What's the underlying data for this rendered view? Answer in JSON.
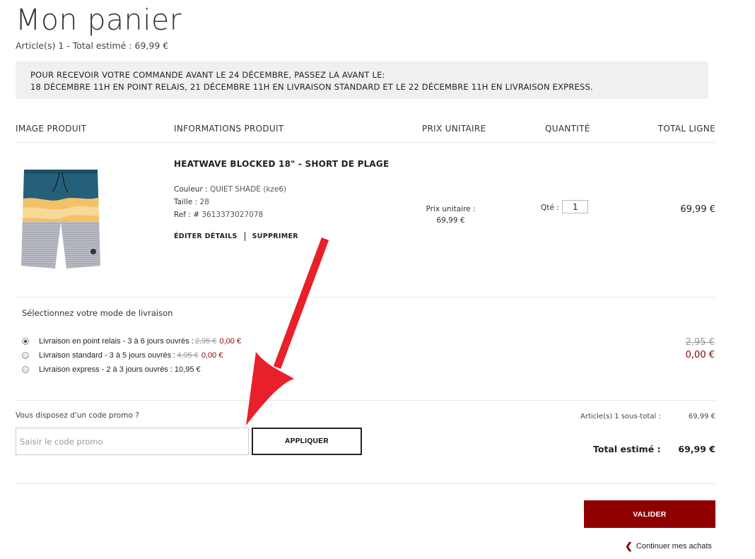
{
  "page": {
    "title": "Mon panier",
    "summary": "Article(s) 1 - Total estimé : 69,99 €"
  },
  "notice": {
    "line1": "POUR RECEVOIR VOTRE COMMANDE AVANT LE 24 DÉCEMBRE, PASSEZ LA AVANT LE:",
    "line2": "18 DÉCEMBRE 11H EN POINT RELAIS, 21 DÉCEMBRE 11H EN LIVRAISON STANDARD ET LE 22 DÉCEMBRE 11H EN LIVRAISON EXPRESS."
  },
  "table": {
    "headers": {
      "image": "IMAGE PRODUIT",
      "info": "INFORMATIONS PRODUIT",
      "unit_price": "PRIX UNITAIRE",
      "quantity": "QUANTITÉ",
      "line_total": "TOTAL LIGNE"
    }
  },
  "item": {
    "name": "HEATWAVE BLOCKED 18\" - SHORT DE PLAGE",
    "color_label": "Couleur :",
    "color_value": "QUIET SHADE (kze6)",
    "size_label": "Taille :",
    "size_value": "28",
    "ref_label": "Ref : #",
    "ref_value": "3613373027078",
    "edit_label": "ÉDITER DÉTAILS",
    "delete_label": "SUPPRIMER",
    "unit_price_label": "Prix unitaire :",
    "unit_price": "69,99 €",
    "qty_label": "Qté :",
    "qty_value": "1",
    "line_total": "69,99 €"
  },
  "shipping": {
    "title": "Sélectionnez votre mode de livraison",
    "options": [
      {
        "label": "Livraison en point relais - 3 à 6 jours ouvrés :",
        "old_price": "2,95 €",
        "price": "0,00 €",
        "selected": true
      },
      {
        "label": "Livraison standard - 3 à 5 jours ouvrés :",
        "old_price": "4,95 €",
        "price": "0,00 €",
        "selected": false
      },
      {
        "label": "Livraison express - 2 à 3 jours ouvrés :",
        "old_price": "",
        "price": "10,95 €",
        "selected": false
      }
    ],
    "old_total": "2,95 €",
    "total": "0,00 €"
  },
  "promo": {
    "question": "Vous disposez d'un code promo ?",
    "placeholder": "Saisir le code promo",
    "apply_label": "APPLIQUER"
  },
  "totals": {
    "subtotal_label": "Article(s) 1 sous-total :",
    "subtotal_value": "69,99 €",
    "total_label": "Total estimé :",
    "total_value": "69,99 €"
  },
  "actions": {
    "validate_label": "VALIDER",
    "continue_label": "Continuer mes achats"
  },
  "colors": {
    "accent": "#8e0000",
    "annotation_arrow": "#e8202a"
  }
}
